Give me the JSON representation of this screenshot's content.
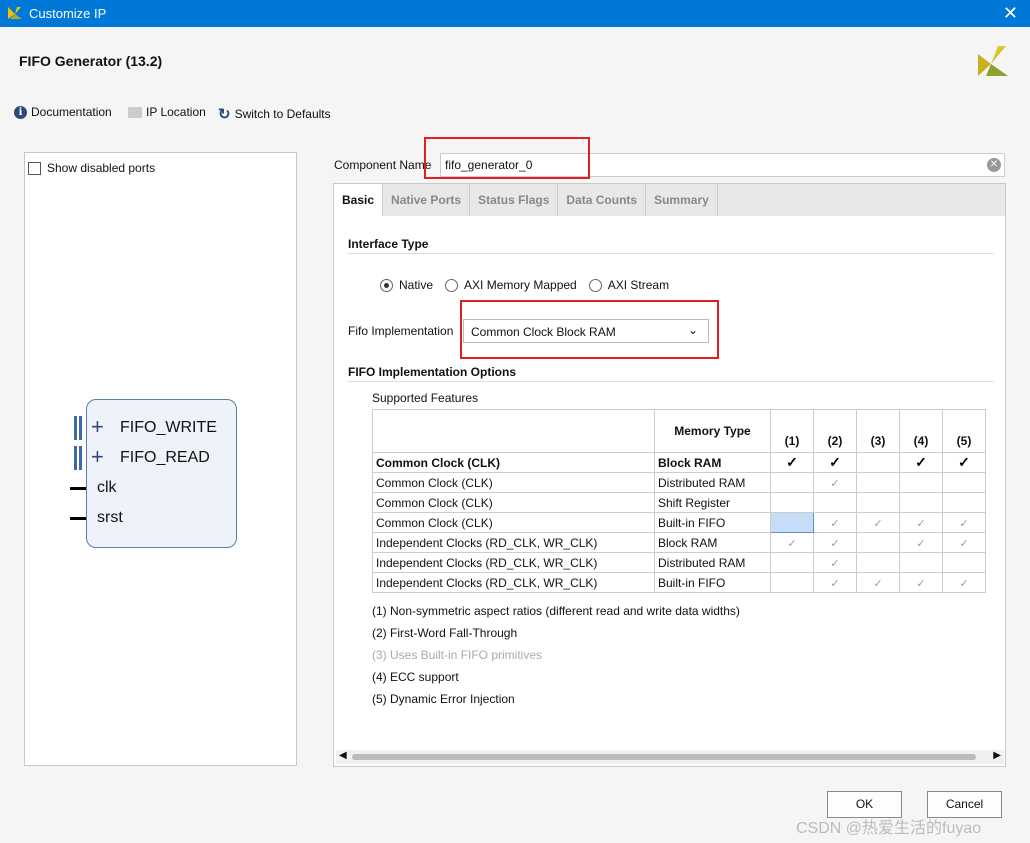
{
  "window": {
    "title": "Customize IP",
    "close": "✕"
  },
  "header": {
    "title": "FIFO Generator (13.2)"
  },
  "toolbar": {
    "documentation": "Documentation",
    "ip_location": "IP Location",
    "defaults": "Switch to Defaults"
  },
  "left": {
    "show_disabled": "Show disabled ports",
    "ports": [
      "FIFO_WRITE",
      "FIFO_READ",
      "clk",
      "srst"
    ]
  },
  "component": {
    "label": "Component Name",
    "value": "fifo_generator_0"
  },
  "tabs": [
    "Basic",
    "Native Ports",
    "Status Flags",
    "Data Counts",
    "Summary"
  ],
  "basic": {
    "interface_title": "Interface Type",
    "interface_options": [
      "Native",
      "AXI Memory Mapped",
      "AXI Stream"
    ],
    "interface_selected": "Native",
    "impl_label": "Fifo Implementation",
    "impl_value": "Common Clock Block RAM",
    "options_title": "FIFO Implementation Options",
    "supported": "Supported Features",
    "table": {
      "headers": [
        "",
        "Memory Type",
        "(1)",
        "(2)",
        "(3)",
        "(4)",
        "(5)"
      ],
      "rows": [
        {
          "clock": "Common Clock (CLK)",
          "memory": "Block RAM",
          "bold": true,
          "checks": [
            "bold",
            "bold",
            "",
            "bold",
            "bold"
          ]
        },
        {
          "clock": "Common Clock (CLK)",
          "memory": "Distributed RAM",
          "checks": [
            "",
            "gray",
            "",
            "",
            ""
          ]
        },
        {
          "clock": "Common Clock (CLK)",
          "memory": "Shift Register",
          "checks": [
            "",
            "",
            "",
            "",
            ""
          ]
        },
        {
          "clock": "Common Clock (CLK)",
          "memory": "Built-in FIFO",
          "checks": [
            "highlight",
            "gray",
            "gray",
            "gray",
            "gray"
          ]
        },
        {
          "clock": "Independent Clocks (RD_CLK, WR_CLK)",
          "memory": "Block RAM",
          "checks": [
            "gray",
            "gray",
            "",
            "gray",
            "gray"
          ]
        },
        {
          "clock": "Independent Clocks (RD_CLK, WR_CLK)",
          "memory": "Distributed RAM",
          "checks": [
            "",
            "gray",
            "",
            "",
            ""
          ]
        },
        {
          "clock": "Independent Clocks (RD_CLK, WR_CLK)",
          "memory": "Built-in FIFO",
          "checks": [
            "",
            "gray",
            "gray",
            "gray",
            "gray"
          ]
        }
      ]
    },
    "notes": [
      "(1) Non-symmetric aspect ratios (different read and write data widths)",
      "(2) First-Word Fall-Through",
      "(3) Uses Built-in FIFO primitives",
      "(4) ECC support",
      "(5) Dynamic Error Injection"
    ]
  },
  "buttons": {
    "ok": "OK",
    "cancel": "Cancel"
  },
  "watermark": "CSDN @热爱生活的fuyao",
  "colors": {
    "titlebar": "#0078d7",
    "highlight": "#e02020",
    "selected_cell": "#c7dcf7"
  }
}
